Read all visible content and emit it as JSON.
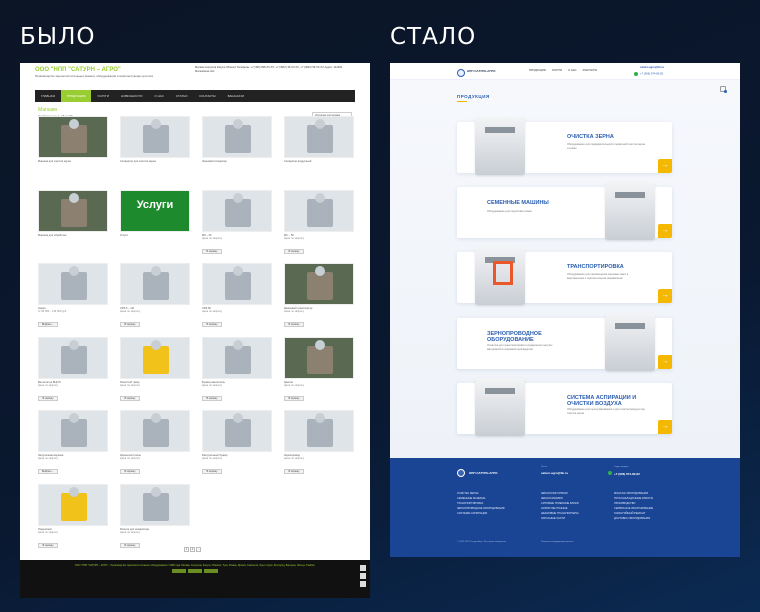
{
  "labels": {
    "before": "БЫЛО",
    "after": "СТАЛО"
  },
  "old": {
    "logo": "ООО \"НПП \"САТУРН – АГРО\"",
    "tagline": "Производство зерноочистительных машин, оборудования и комплектующих для них",
    "contact": "Москва  Серпухов  Калуга  Обнинск\nТелефоны: +7 (495) 998-XX-XX, +7 (4967) 35-XX-XX, +7 (4842) 59-XX-XX\nАдрес: 142300, Московская обл.",
    "nav": [
      "Главная",
      "Продукция",
      "Услуги",
      "Новинности",
      "О нас",
      "Статьи",
      "Контакты",
      "Вакансии"
    ],
    "nav_active": 1,
    "title": "Магазин",
    "result": "Отображение 1–36 из 56",
    "sort": "Исходная сортировка",
    "products": [
      {
        "name": "Машина для очистки зерна",
        "price": "",
        "btn": "",
        "style": "photo"
      },
      {
        "name": "Сепаратор для очистки зерна",
        "price": "",
        "btn": "",
        "style": "gray"
      },
      {
        "name": "Зерновой сепаратор",
        "price": "",
        "btn": "",
        "style": "gray"
      },
      {
        "name": "Сепаратор воздушный",
        "price": "",
        "btn": "",
        "style": "gray"
      },
      {
        "name": "Машина для обработки",
        "price": "",
        "btn": "",
        "style": "photo"
      },
      {
        "name": "Услуги",
        "price": "",
        "btn": "",
        "style": "green"
      },
      {
        "name": "МЗ – 20",
        "price": "Цена по запросу",
        "btn": "В корзину",
        "style": "gray"
      },
      {
        "name": "МС – 50",
        "price": "Цена по запросу",
        "btn": "В корзину",
        "style": "gray"
      },
      {
        "name": "Нория",
        "price": "от 95 000 – 115 000 руб.",
        "btn": "Выбрать…",
        "style": "gray"
      },
      {
        "name": "СРЗ-5 – 1М",
        "price": "Цена по запросу",
        "btn": "В корзину",
        "style": "gray"
      },
      {
        "name": "СРЗ-5К",
        "price": "Цена по запросу",
        "btn": "В корзину",
        "style": "gray"
      },
      {
        "name": "Шнековый транспортер",
        "price": "Цена по запросу",
        "btn": "В корзину",
        "style": "photo"
      },
      {
        "name": "Вентилятор ВЦП-5",
        "price": "Цена по запросу",
        "btn": "В корзину",
        "style": "gray"
      },
      {
        "name": "Ячеистый триер",
        "price": "Цена по запросу",
        "btn": "В корзину",
        "style": "yellow"
      },
      {
        "name": "Бункер-накопитель",
        "price": "Цена по запросу",
        "btn": "В корзину",
        "style": "gray"
      },
      {
        "name": "Циклон",
        "price": "Цена по запросу",
        "btn": "В корзину",
        "style": "photo"
      },
      {
        "name": "Загрузочная воронка",
        "price": "Цена по запросу",
        "btn": "Выбрать…",
        "style": "gray"
      },
      {
        "name": "Зерноочиститель",
        "price": "Цена по запросу",
        "btn": "В корзину",
        "style": "gray"
      },
      {
        "name": "Разгрузочный бункер",
        "price": "Цена по запросу",
        "btn": "В корзину",
        "style": "gray"
      },
      {
        "name": "Зернопровод",
        "price": "Цена по запросу",
        "btn": "В корзину",
        "style": "gray"
      },
      {
        "name": "Подшипник",
        "price": "Цена по запросу",
        "btn": "В корзину",
        "style": "yellow"
      },
      {
        "name": "Решета для сепаратора",
        "price": "Цена по запросу",
        "btn": "В корзину",
        "style": "gray"
      }
    ],
    "pager": [
      "1",
      "2",
      "→"
    ],
    "footer": "ООО \"НПП \"САТУРН – АГРО\" – Производство зерноочистительного оборудования с 1998 года. Москва, Серпухов, Калуга, Обнинск, Тула, Рязань, Брянск, Смоленск, Орел, Курск, Белгород, Воронеж, Липецк, Тамбов."
  },
  "new": {
    "brand": "НПП САТУРН-АГРО",
    "menu": [
      "Продукция",
      "Услуги",
      "О нас",
      "Контакты"
    ],
    "email": "saturn-agro@bk.ru",
    "phone": "+7 (906) 674-82-82",
    "section": "ПРОДУКЦИЯ",
    "cards": [
      {
        "title": "Очистка зерна",
        "desc": "Оборудование для предварительной и первичной очистки зерна и семян"
      },
      {
        "title": "Семенные машины",
        "desc": "Оборудование для подготовки семян"
      },
      {
        "title": "Транспортировка",
        "desc": "Оборудование для перемещения зерновых масс в вертикальном и горизонтальном направлении"
      },
      {
        "title": "Зернопроводное оборудование",
        "desc": "Оснастка для транспортировки и разделения сыпучих материалов в зерновом производстве"
      },
      {
        "title": "Система аспирации и очистки воздуха",
        "desc": "Оборудование для пылеулавливания и для очистки воздуха при очистке зерна"
      }
    ],
    "footer": {
      "brand": "НПП САТУРН-АГРО",
      "email_label": "Почта",
      "email": "saturn-agro@bk.ru",
      "phone_label": "Отдел продаж",
      "phone": "+7 (906) 674-82-82",
      "col1": [
        "Очистка зерна",
        "Семенные машины",
        "Транспортировка",
        "Зернопроводное оборудование",
        "Системы аспирации"
      ],
      "col2": [
        "Зерноочистители",
        "Зерносушилки",
        "Ситовые триерные блоки",
        "Нории ленточные",
        "Шнековые транспортеры",
        "Запасные части"
      ],
      "col3": [
        "Монтаж оборудования",
        "Пусконаладочные работы",
        "Производство",
        "Сервисное обслуживание",
        "Гарантийный ремонт",
        "Доставка оборудования"
      ],
      "copy1": "© 2022 НПП Сатурн-Агро. Все права защищены.",
      "copy2": "Политика конфиденциальности"
    }
  }
}
